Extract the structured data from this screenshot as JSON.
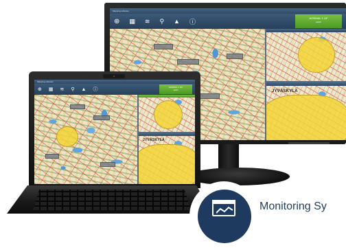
{
  "monitor": {
    "title_text": "Mapping software",
    "status": {
      "line1": "NORMAL 1 OF",
      "line2": "watch"
    },
    "map_city_label": "JYVÄSKYLÄ",
    "toolbar_icons": [
      "zoom-icon",
      "map-icon",
      "layers-icon",
      "filter-icon",
      "pin-icon",
      "info-icon"
    ]
  },
  "laptop": {
    "title_text": "Mapping software",
    "status": {
      "line1": "NORMAL 1 OF",
      "line2": "watch"
    },
    "map_city_label": "JYVÄSKYLÄ"
  },
  "badge": {
    "icon": "monitor-window-icon",
    "text": "Monitoring Sy"
  },
  "colors": {
    "toolbar": "#2f4966",
    "status_green": "#5fae30",
    "alert_area": "#f4d632",
    "brand_navy": "#1e3a5f"
  }
}
